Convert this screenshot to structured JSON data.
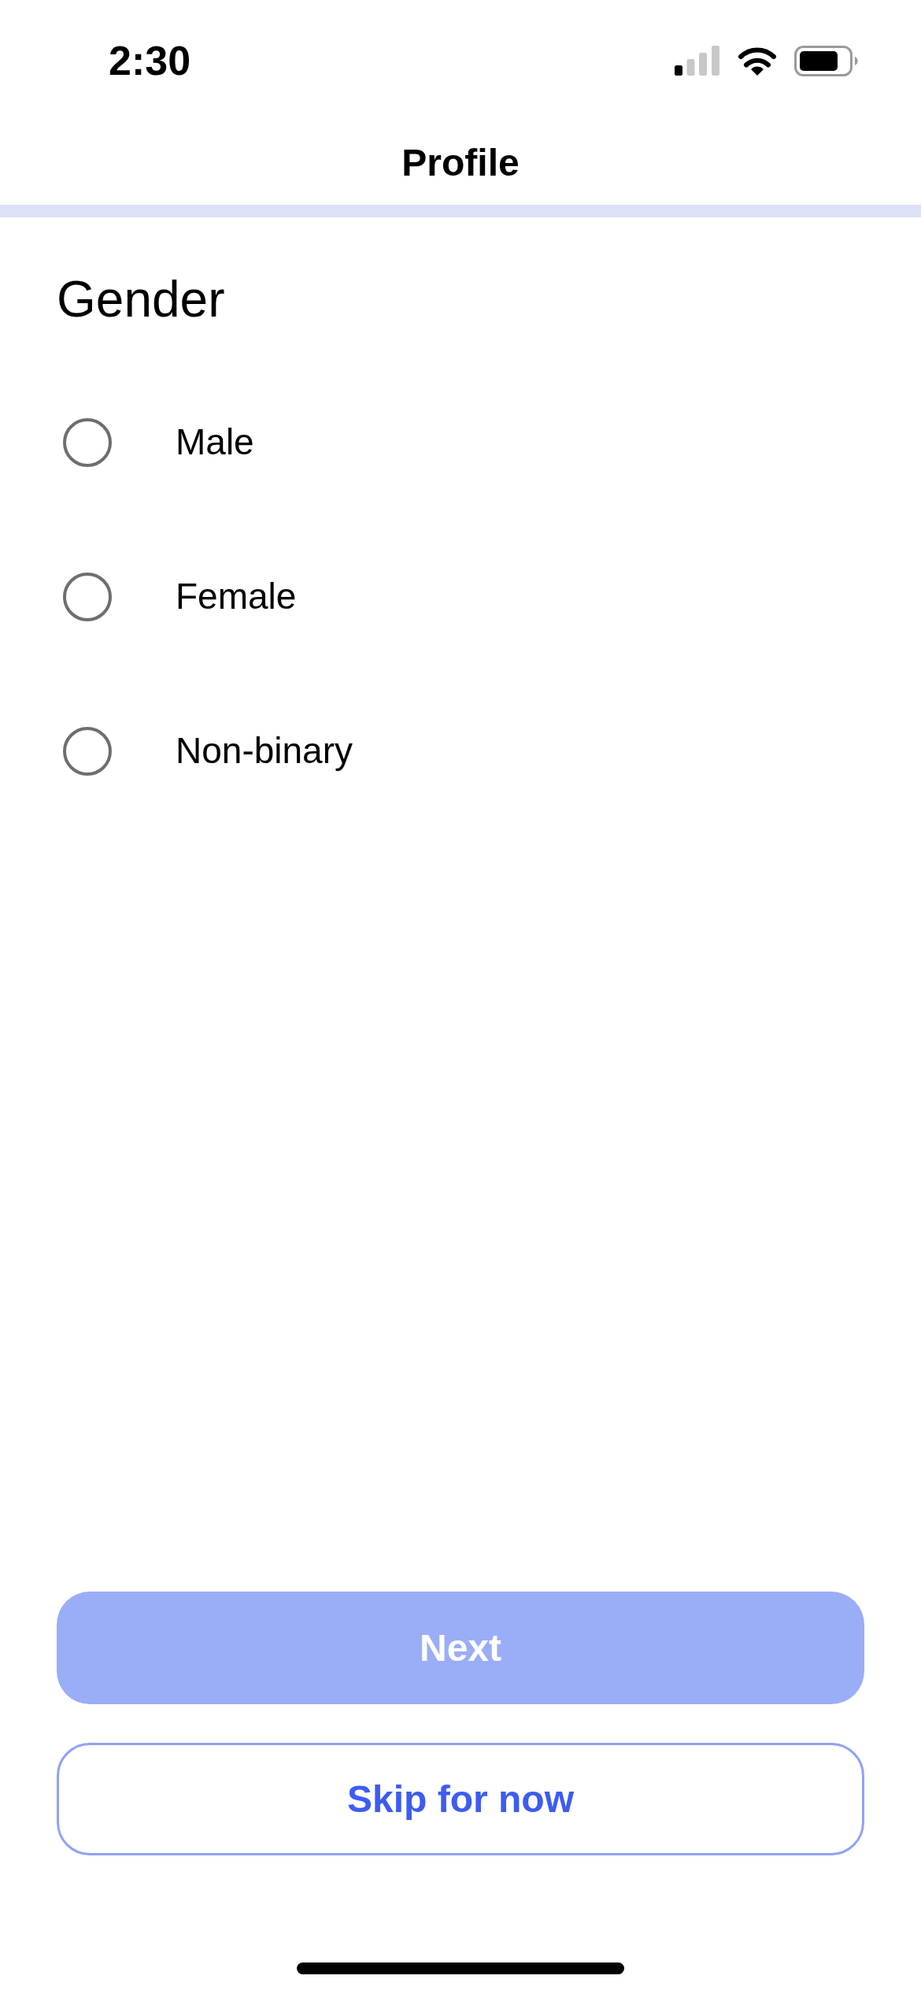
{
  "status_bar": {
    "time": "2:30"
  },
  "nav": {
    "title": "Profile"
  },
  "question": {
    "title": "Gender",
    "options": [
      {
        "label": "Male",
        "selected": false
      },
      {
        "label": "Female",
        "selected": false
      },
      {
        "label": "Non-binary",
        "selected": false
      }
    ]
  },
  "buttons": [
    {
      "kind": "primary",
      "label": "Next",
      "disabled": true
    },
    {
      "kind": "secondary",
      "label": "Skip for now",
      "disabled": false
    }
  ]
}
